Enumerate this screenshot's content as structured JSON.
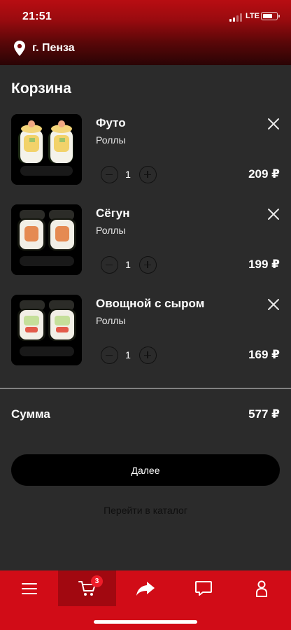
{
  "status_bar": {
    "time": "21:51",
    "network": "LTE",
    "battery_percent": 55
  },
  "header": {
    "city": "г. Пенза"
  },
  "page": {
    "title": "Корзина"
  },
  "cart": {
    "items": [
      {
        "name": "Футо",
        "category": "Роллы",
        "quantity": "1",
        "price": "209 ₽",
        "image": "futo-roll-image"
      },
      {
        "name": "Сёгун",
        "category": "Роллы",
        "quantity": "1",
        "price": "199 ₽",
        "image": "segun-roll-image"
      },
      {
        "name": "Овощной с сыром",
        "category": "Роллы",
        "quantity": "1",
        "price": "169 ₽",
        "image": "vegetable-cheese-roll-image"
      }
    ],
    "total_label": "Сумма",
    "total_value": "577 ₽"
  },
  "actions": {
    "next_label": "Далее",
    "catalog_label": "Перейти в каталог"
  },
  "tabbar": {
    "tabs": [
      {
        "icon": "menu-icon",
        "active": false
      },
      {
        "icon": "cart-icon",
        "active": true,
        "badge": "3"
      },
      {
        "icon": "share-icon",
        "active": false
      },
      {
        "icon": "chat-icon",
        "active": false
      },
      {
        "icon": "profile-icon",
        "active": false
      }
    ]
  },
  "colors": {
    "brand_red": "#d10c17",
    "active_tab": "#a10810",
    "background": "#2b2b2b",
    "button": "#000000",
    "badge": "#ef1c28"
  }
}
